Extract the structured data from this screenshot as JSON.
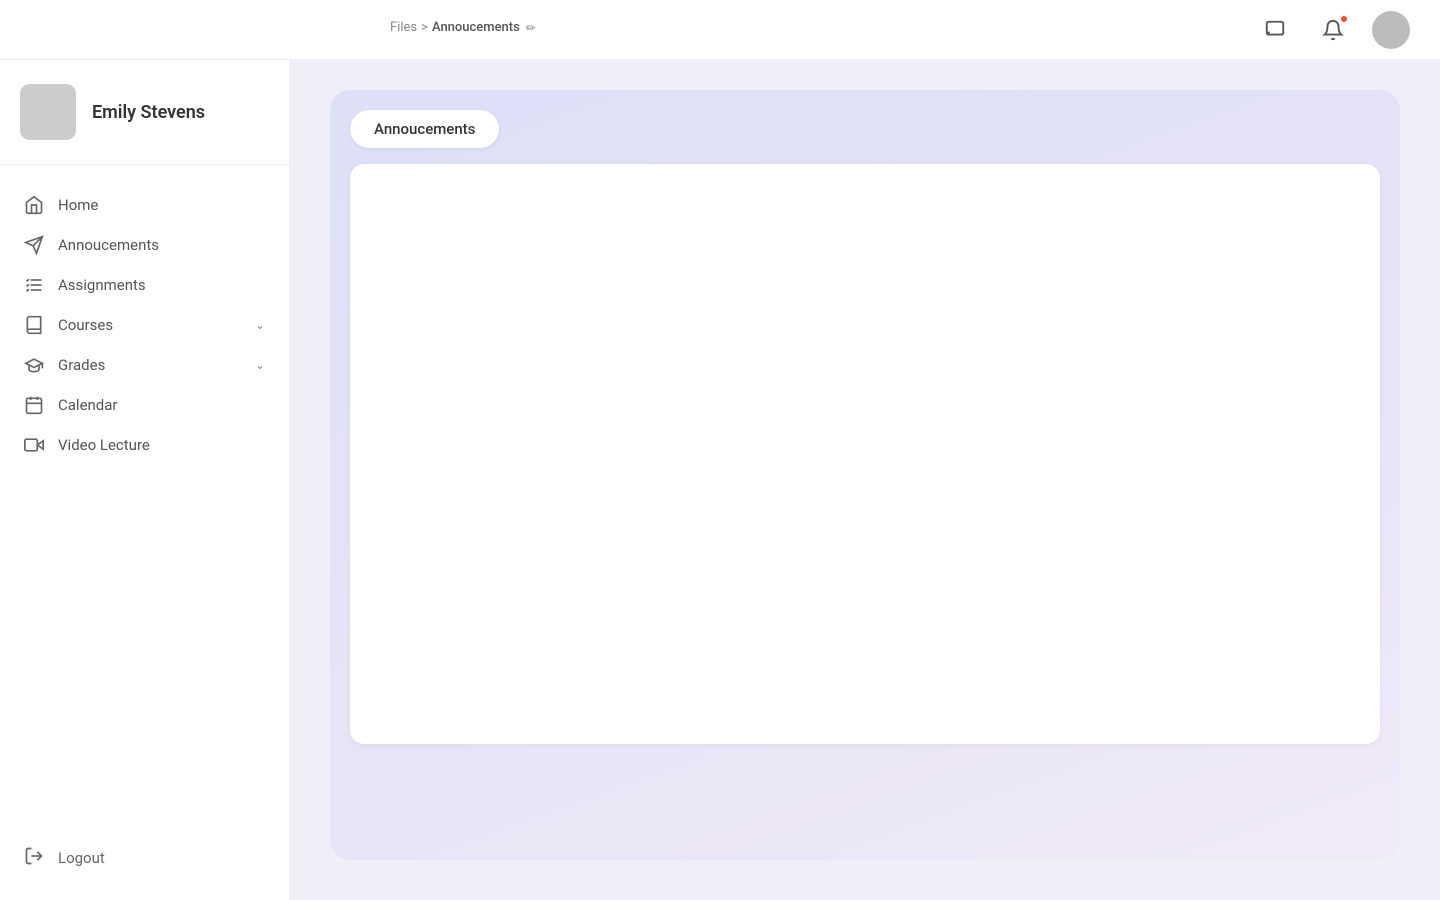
{
  "topbar": {
    "chat_icon": "chat-icon",
    "bell_icon": "bell-icon",
    "has_notification": true,
    "avatar_alt": "user avatar"
  },
  "breadcrumb": {
    "files_label": "Files",
    "separator": ">",
    "current_label": "Annoucements",
    "edit_icon": "✏"
  },
  "sidebar": {
    "user": {
      "name": "Emily Stevens"
    },
    "nav_items": [
      {
        "id": "home",
        "label": "Home",
        "icon": "home"
      },
      {
        "id": "annoucements",
        "label": "Annoucements",
        "icon": "megaphone"
      },
      {
        "id": "assignments",
        "label": "Assignments",
        "icon": "list-check"
      },
      {
        "id": "courses",
        "label": "Courses",
        "icon": "book",
        "has_chevron": true
      },
      {
        "id": "grades",
        "label": "Grades",
        "icon": "graduation-cap",
        "has_chevron": true
      },
      {
        "id": "calendar",
        "label": "Calendar",
        "icon": "calendar"
      },
      {
        "id": "video-lecture",
        "label": "Video Lecture",
        "icon": "video"
      }
    ],
    "logout_label": "Logout"
  },
  "main": {
    "tab_label": "Annoucements",
    "content": ""
  }
}
